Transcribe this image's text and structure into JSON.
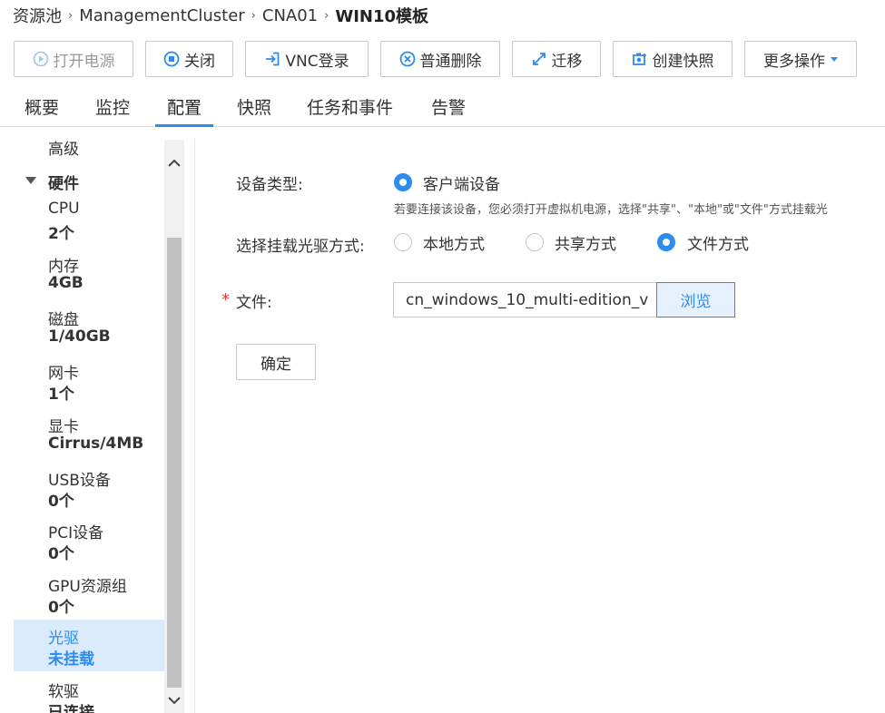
{
  "breadcrumb": {
    "items": [
      "资源池",
      "ManagementCluster",
      "CNA01"
    ],
    "current": "WIN10模板"
  },
  "toolbar": {
    "power_on": "打开电源",
    "shutdown": "关闭",
    "vnc_login": "VNC登录",
    "delete": "普通删除",
    "migrate": "迁移",
    "snapshot": "创建快照",
    "more": "更多操作"
  },
  "tabs": [
    "概要",
    "监控",
    "配置",
    "快照",
    "任务和事件",
    "告警"
  ],
  "active_tab": "配置",
  "sidebar": {
    "advanced": "高级",
    "hardware_header": "硬件",
    "items": [
      {
        "name": "CPU",
        "value": "2个"
      },
      {
        "name": "内存",
        "value": "4GB"
      },
      {
        "name": "磁盘",
        "value": "1/40GB"
      },
      {
        "name": "网卡",
        "value": "1个"
      },
      {
        "name": "显卡",
        "value": "Cirrus/4MB"
      },
      {
        "name": "USB设备",
        "value": "0个"
      },
      {
        "name": "PCI设备",
        "value": "0个"
      },
      {
        "name": "GPU资源组",
        "value": "0个"
      },
      {
        "name": "光驱",
        "value": "未挂载"
      },
      {
        "name": "软驱",
        "value": "已连接"
      }
    ],
    "selected": "光驱"
  },
  "form": {
    "device_type_label": "设备类型:",
    "device_type_option": "客户端设备",
    "device_hint": "若要连接该设备，您必须打开虚拟机电源，选择\"共享\"、\"本地\"或\"文件\"方式挂载光",
    "mount_mode_label": "选择挂载光驱方式:",
    "mount_options": [
      "本地方式",
      "共享方式",
      "文件方式"
    ],
    "mount_selected": "文件方式",
    "required_mark": "*",
    "file_label": "文件:",
    "file_value": "cn_windows_10_multi-edition_v",
    "browse": "浏览",
    "ok": "确定"
  },
  "colors": {
    "accent": "#2d8cf0",
    "selected_bg": "#d9ebfc",
    "required": "#e53935"
  }
}
